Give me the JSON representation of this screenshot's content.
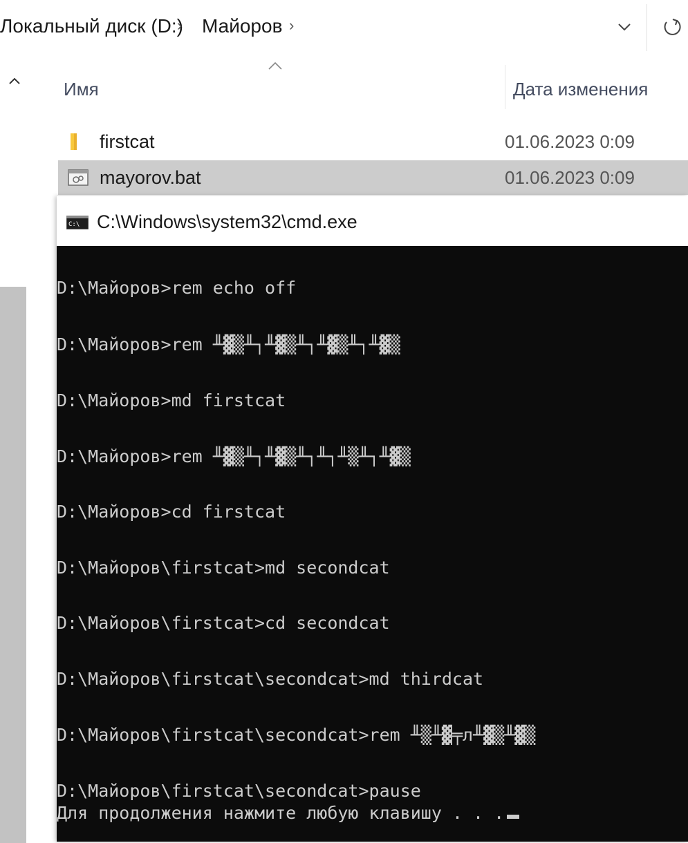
{
  "address_bar": {
    "crumbs": [
      "Локальный диск (D:)",
      "Майоров"
    ],
    "separator": "›"
  },
  "columns": {
    "name": "Имя",
    "date_modified": "Дата изменения"
  },
  "files": [
    {
      "name": "firstcat",
      "date": "01.06.2023 0:09",
      "icon": "folder-icon",
      "selected": false
    },
    {
      "name": "mayorov.bat",
      "date": "01.06.2023 0:09",
      "icon": "batch-file-icon",
      "selected": true
    }
  ],
  "console": {
    "title": "C:\\Windows\\system32\\cmd.exe",
    "lines": [
      "D:\\Майоров>rem echo off",
      "D:\\Майоров>rem ╨▓▒╨┐╨▓▒╨┐╨▓▒╨┐╨▓▒",
      "D:\\Майоров>md firstcat",
      "D:\\Майоров>rem ╨▓▒╨┐╨▓▒╨┐╨┐╨▒╨┐╨▓▒",
      "D:\\Майоров>cd firstcat",
      "D:\\Майоров\\firstcat>md secondcat",
      "D:\\Майоров\\firstcat>cd secondcat",
      "D:\\Майоров\\firstcat\\secondcat>md thirdcat",
      "D:\\Майоров\\firstcat\\secondcat>rem ╨▒╨▓╤л╨▓▒╨▓▒",
      "D:\\Майоров\\firstcat\\secondcat>pause",
      "Для продолжения нажмите любую клавишу . . ."
    ],
    "text_color": "#cccccc",
    "background": "#0c0c0c"
  },
  "colors": {
    "selection": "#cccccc",
    "scroll_track": "#c2c2c2",
    "folder": "#f8c83c"
  }
}
